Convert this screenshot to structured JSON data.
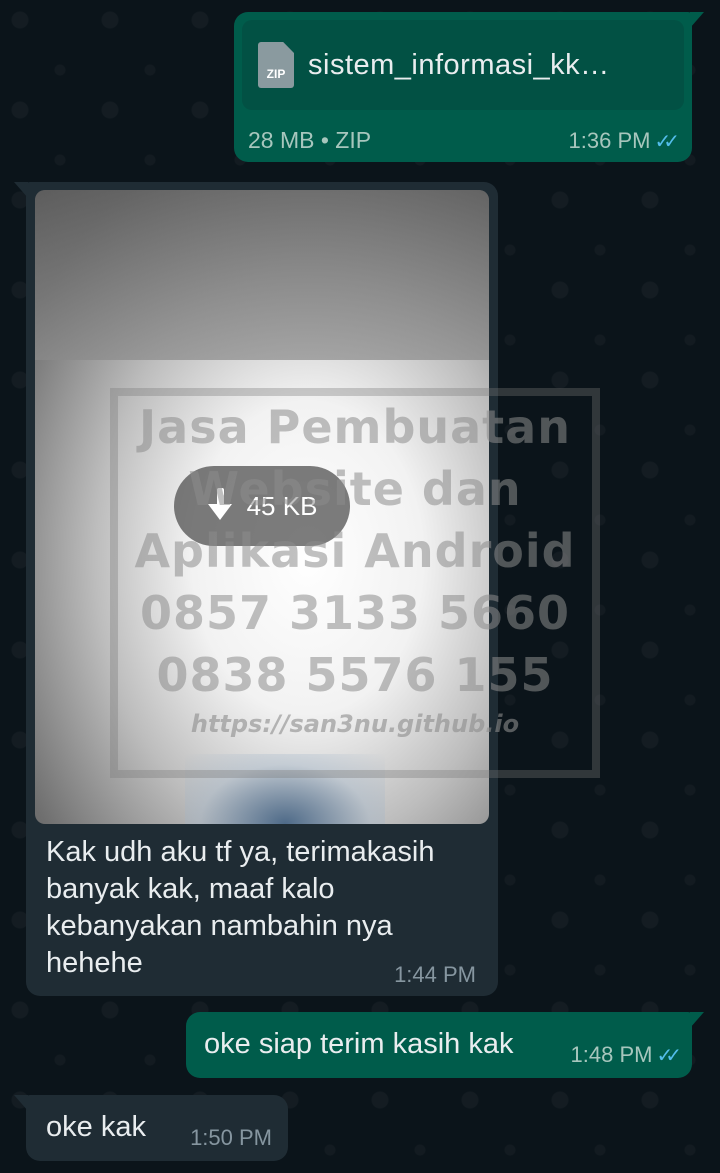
{
  "colors": {
    "background": "#0b141a",
    "outgoing_bubble": "#005c4b",
    "incoming_bubble": "#1f2c34",
    "read_ticks": "#53bdeb"
  },
  "messages": {
    "file": {
      "icon": "zip-file-icon",
      "icon_label": "ZIP",
      "name": "sistem_informasi_kk…",
      "meta": "28 MB • ZIP",
      "time": "1:36 PM",
      "ticks": "✓✓"
    },
    "image": {
      "download_icon": "download-arrow-icon",
      "download_size": "45 KB",
      "watermark_lines": [
        "Jasa Pembuatan",
        "Website dan",
        "Aplikasi Android",
        "0857 3133 5660",
        "0838 5576 155"
      ],
      "watermark_url": "https://san3nu.github.io",
      "caption": "Kak udh aku tf ya, terimakasih banyak kak, maaf kalo kebanyakan nambahin nya hehehe",
      "time": "1:44 PM"
    },
    "out_short": {
      "text": "oke siap terim kasih kak",
      "time": "1:48 PM",
      "ticks": "✓✓"
    },
    "in_short": {
      "text": "oke kak",
      "time": "1:50 PM"
    }
  }
}
